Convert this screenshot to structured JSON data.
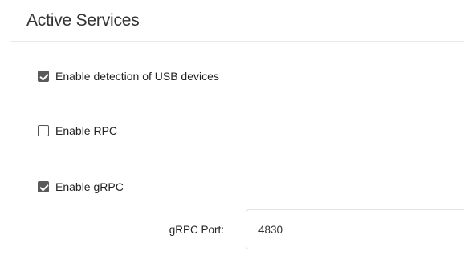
{
  "panel": {
    "title": "Active Services"
  },
  "options": [
    {
      "label": "Enable detection of USB devices",
      "checked": true
    },
    {
      "label": "Enable RPC",
      "checked": false
    },
    {
      "label": "Enable gRPC",
      "checked": true
    }
  ],
  "grpc_port": {
    "label": "gRPC Port:",
    "value": "4830"
  }
}
